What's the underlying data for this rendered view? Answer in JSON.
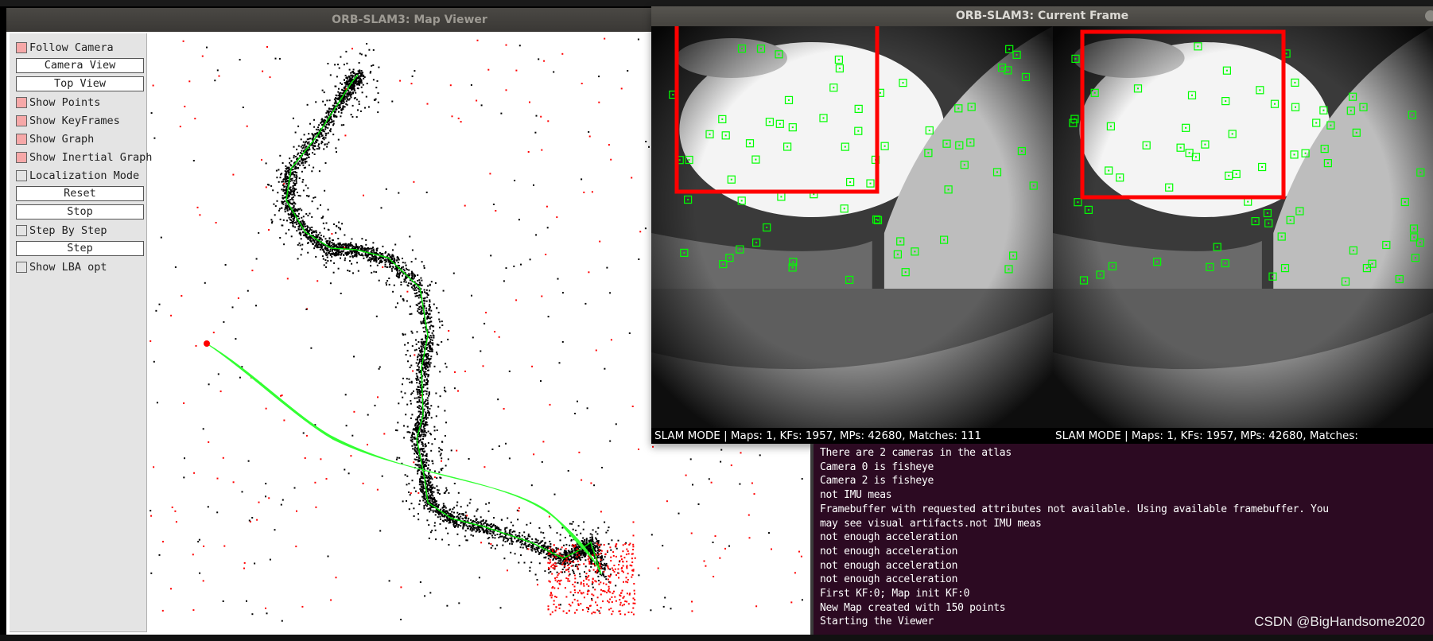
{
  "map_viewer": {
    "title": "ORB-SLAM3: Map Viewer",
    "panel": {
      "items": [
        {
          "type": "checkbox",
          "label": "Follow Camera",
          "checked": true
        },
        {
          "type": "button",
          "label": "Camera View"
        },
        {
          "type": "button",
          "label": "Top View"
        },
        {
          "type": "checkbox",
          "label": "Show Points",
          "checked": true
        },
        {
          "type": "checkbox",
          "label": "Show KeyFrames",
          "checked": true
        },
        {
          "type": "checkbox",
          "label": "Show Graph",
          "checked": true
        },
        {
          "type": "checkbox",
          "label": "Show Inertial Graph",
          "checked": true
        },
        {
          "type": "checkbox",
          "label": "Localization Mode",
          "checked": false
        },
        {
          "type": "button",
          "label": "Reset"
        },
        {
          "type": "button",
          "label": "Stop"
        },
        {
          "type": "checkbox",
          "label": "Step By Step",
          "checked": false
        },
        {
          "type": "button",
          "label": "Step"
        },
        {
          "type": "checkbox",
          "label": "Show LBA opt",
          "checked": false
        }
      ]
    },
    "colors": {
      "map_points": "#000000",
      "reference_points": "#ff0000",
      "keyframe_trajectory": "#00e000",
      "inertial_graph": "#33ff33"
    }
  },
  "current_frame": {
    "title": "ORB-SLAM3: Current Frame",
    "status_left": "SLAM MODE |  Maps: 1, KFs: 1957, MPs: 42680, Matches: 111",
    "status_right": "SLAM MODE |  Maps: 1, KFs: 1957, MPs: 42680, Matches:",
    "colors": {
      "feature_box": "#00ff00",
      "highlight_box": "#ff0000"
    }
  },
  "terminal": {
    "lines": [
      "There are 2 cameras in the atlas",
      "Camera 0 is fisheye",
      "Camera 2 is fisheye",
      "not IMU meas",
      "Framebuffer with requested attributes not available. Using available framebuffer. You",
      " may see visual artifacts.not IMU meas",
      "not enough acceleration",
      "not enough acceleration",
      "not enough acceleration",
      "not enough acceleration",
      "First KF:0; Map init KF:0",
      "New Map created with 150 points",
      "Starting the Viewer"
    ],
    "watermark": "CSDN @BigHandsome2020"
  }
}
